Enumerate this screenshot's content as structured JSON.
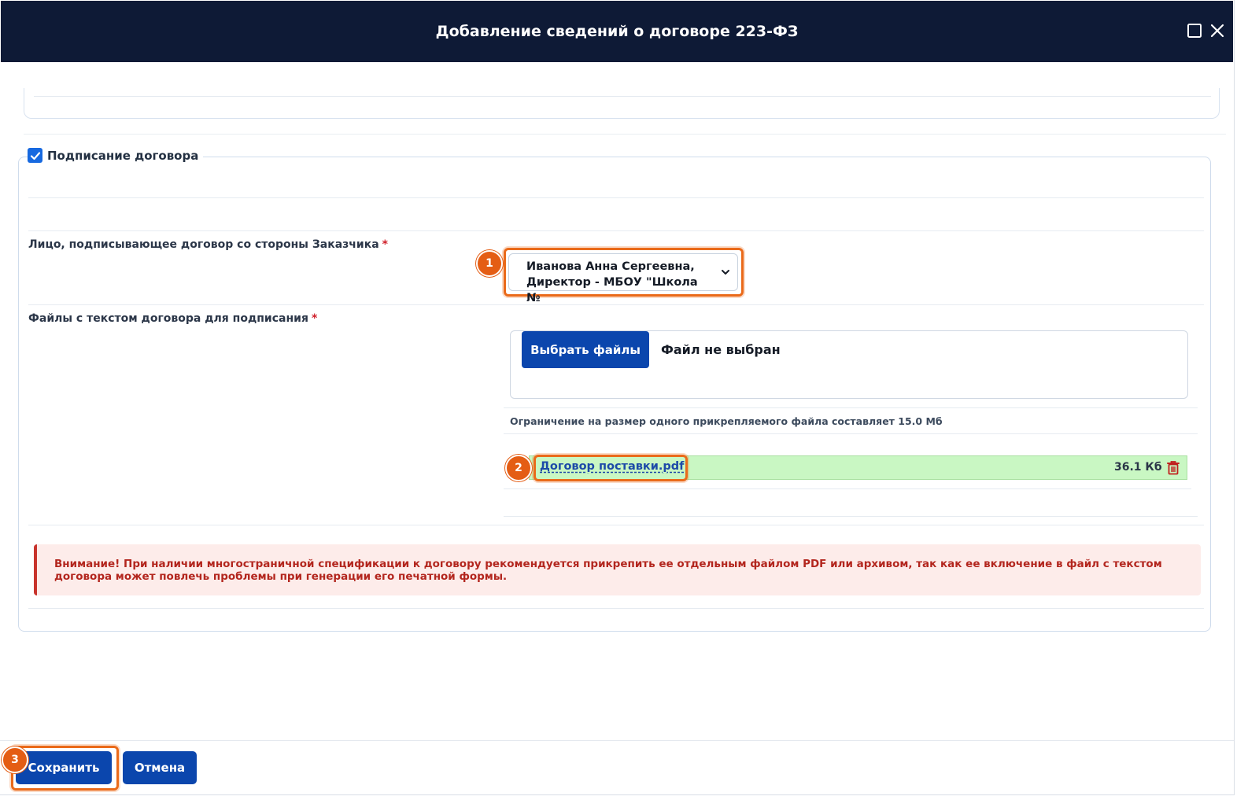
{
  "dialog": {
    "title": "Добавление сведений о договоре 223-ФЗ",
    "maximize_icon": "maximize-icon",
    "close_icon": "close-icon"
  },
  "signing": {
    "checkbox_checked": true,
    "section_label": "Подписание договора",
    "signer_label": "Лицо, подписывающее договор со стороны Заказчика",
    "signer_value": "Иванова Анна Сергеевна,\nДиректор - МБОУ \"Школа №",
    "files_label": "Файлы с текстом договора для подписания",
    "required_mark": "*",
    "choose_files_label": "Выбрать файлы",
    "no_file_text": "Файл не выбран",
    "size_limit_text": "Ограничение на размер одного прикрепляемого файла составляет 15.0 Мб",
    "file": {
      "name": "Договор поставки.pdf",
      "size": "36.1 Кб"
    }
  },
  "alert": {
    "text": "Внимание! При наличии многостраничной спецификации к договору рекомендуется прикрепить ее отдельным файлом PDF или архивом, так как ее включение в файл с текстом договора может повлечь проблемы при генерации его печатной формы."
  },
  "footer": {
    "save_label": "Сохранить",
    "cancel_label": "Отмена"
  },
  "annotations": {
    "badge1": "1",
    "badge2": "2",
    "badge3": "3"
  },
  "colors": {
    "header_bg": "#0e1a36",
    "primary_button": "#0b46ad",
    "highlight": "#ea6a1a",
    "file_row_bg": "#c9f7c3",
    "alert_bg": "#fdecea",
    "alert_text": "#b3261e"
  }
}
